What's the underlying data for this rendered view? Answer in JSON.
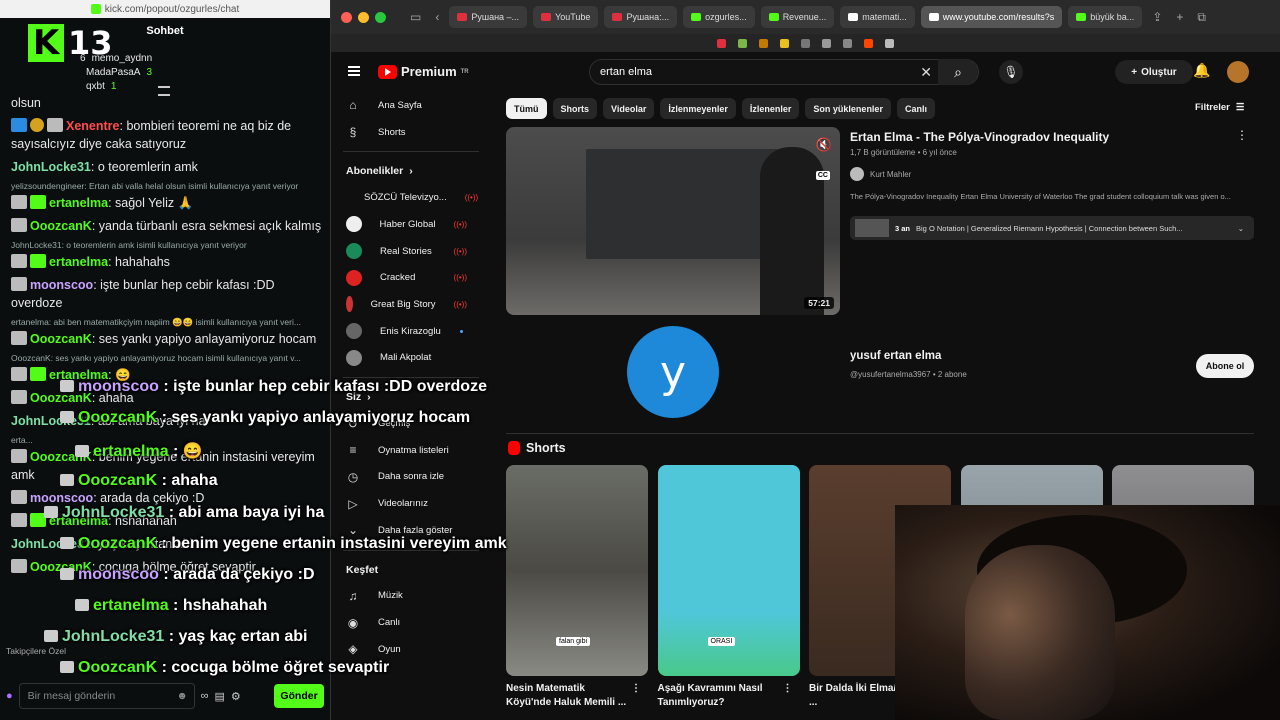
{
  "kick": {
    "url": "kick.com/popout/ozgurles/chat",
    "chat_title": "Sohbet",
    "viewer_k": "K",
    "viewer_count": "13",
    "leaders": [
      {
        "rank": "6",
        "name": "memo_aydnn",
        "val": ""
      },
      {
        "rank": "",
        "name": "MadaPasaA",
        "val": "3"
      },
      {
        "rank": "",
        "name": "qxbt",
        "val": "1"
      }
    ],
    "messages": [
      {
        "reply": "",
        "user": "",
        "color": "#e8e8e8",
        "badges": [],
        "text": "olsun"
      },
      {
        "reply": "",
        "user": "Xenentre",
        "color": "#ff4d4d",
        "badges": [
          "b-blue",
          "b-gold",
          "b-sub"
        ],
        "text": "bombieri teoremi ne aq biz de sayısalcıyız diye caka satıyoruz"
      },
      {
        "reply": "",
        "user": "JohnLocke31",
        "color": "#7ee0a6",
        "badges": [],
        "text": "o teoremlerin amk"
      },
      {
        "reply": "yelizsoundengineer: Ertan abi valla helal olsun isimli kullanıcıya yanıt veriyor",
        "user": "ertanelma",
        "color": "#53fc18",
        "badges": [
          "b-sub",
          "b-gift"
        ],
        "text": "sağol Yeliz 🙏"
      },
      {
        "reply": "",
        "user": "OoozcanK",
        "color": "#53fc18",
        "badges": [
          "b-sub"
        ],
        "text": "yanda türbanlı esra sekmesi açık kalmış"
      },
      {
        "reply": "JohnLocke31: o teoremlerin amk isimli kullanıcıya yanıt veriyor",
        "user": "ertanelma",
        "color": "#53fc18",
        "badges": [
          "b-sub",
          "b-gift"
        ],
        "text": "hahahahs"
      },
      {
        "reply": "",
        "user": "moonscoo",
        "color": "#c8a2ff",
        "badges": [
          "b-sub"
        ],
        "text": "işte bunlar hep cebir kafası :DD overdoze"
      },
      {
        "reply": "ertanelma: abi ben matematikçiyim napiim 😄😄 isimli kullanıcıya yanıt veri...",
        "user": "OoozcanK",
        "color": "#53fc18",
        "badges": [
          "b-sub"
        ],
        "text": "ses yankı yapiyo anlayamiyoruz hocam"
      },
      {
        "reply": "OoozcanK: ses yankı yapiyo anlayamiyoruz hocam isimli kullanıcıya yanıt v...",
        "user": "ertanelma",
        "color": "#53fc18",
        "badges": [
          "b-sub",
          "b-gift"
        ],
        "text": "😄"
      },
      {
        "reply": "",
        "user": "OoozcanK",
        "color": "#53fc18",
        "badges": [
          "b-sub"
        ],
        "text": "ahaha"
      },
      {
        "reply": "",
        "user": "JohnLocke31",
        "color": "#7ee0a6",
        "badges": [],
        "text": "abi ama baya iyi ha"
      },
      {
        "reply": "erta...",
        "user": "OoozcanK",
        "color": "#53fc18",
        "badges": [
          "b-sub"
        ],
        "text": "benim yegene ertanin instasini vereyim amk"
      },
      {
        "reply": "",
        "user": "moonscoo",
        "color": "#c8a2ff",
        "badges": [
          "b-sub"
        ],
        "text": "arada da çekiyo :D"
      },
      {
        "reply": "",
        "user": "ertanelma",
        "color": "#53fc18",
        "badges": [
          "b-sub",
          "b-gift"
        ],
        "text": "hshahahah"
      },
      {
        "reply": "",
        "user": "JohnLocke31",
        "color": "#7ee0a6",
        "badges": [],
        "text": "yaş kaç ertan abi"
      },
      {
        "reply": "",
        "user": "OoozcanK",
        "color": "#53fc18",
        "badges": [
          "b-sub"
        ],
        "text": "cocuga bölme öğret sevaptir"
      }
    ],
    "follow_note": "Takipçilere Özel",
    "input_placeholder": "Bir mesaj gönderin",
    "send_label": "Gönder"
  },
  "overlay": [
    {
      "user": "moonscoo",
      "color": "#c8a2ff",
      "text": " : işte bunlar hep cebir kafası :DD overdoze"
    },
    {
      "user": "OoozcanK",
      "color": "#53fc18",
      "text": " : ses yankı yapiyo anlayamiyoruz hocam"
    },
    {
      "user": "ertanelma",
      "color": "#53fc18",
      "text": " : 😄"
    },
    {
      "user": "OoozcanK",
      "color": "#53fc18",
      "text": " : ahaha"
    },
    {
      "user": "JohnLocke31",
      "color": "#7ee0a6",
      "text": " : abi ama baya iyi ha"
    },
    {
      "user": "OoozcanK",
      "color": "#53fc18",
      "text": " : benim yegene ertanin instasini vereyim amk"
    },
    {
      "user": "moonscoo",
      "color": "#c8a2ff",
      "text": " : arada da çekiyo :D"
    },
    {
      "user": "ertanelma",
      "color": "#53fc18",
      "text": " : hshahahah"
    },
    {
      "user": "JohnLocke31",
      "color": "#7ee0a6",
      "text": " : yaş kaç ertan abi"
    },
    {
      "user": "OoozcanK",
      "color": "#53fc18",
      "text": " : cocuga bölme öğret sevaptir"
    }
  ],
  "tabs": [
    {
      "label": "Рушана –...",
      "color": "#e03040"
    },
    {
      "label": "YouTube",
      "color": "#e03040"
    },
    {
      "label": "Рушана:...",
      "color": "#e03040"
    },
    {
      "label": "ozgurles...",
      "color": "#53fc18"
    },
    {
      "label": "Revenue...",
      "color": "#53fc18"
    },
    {
      "label": "matemati...",
      "color": "#ffffff"
    },
    {
      "label": "www.youtube.com/results?s",
      "color": "#ffffff",
      "active": true
    },
    {
      "label": "büyük ba...",
      "color": "#53fc18"
    }
  ],
  "youtube": {
    "brand": "Premium",
    "brand_sup": "TR",
    "search_value": "ertan elma",
    "create_label": "Oluştur",
    "sidebar": {
      "top": [
        {
          "label": "Ana Sayfa",
          "icon": "⌂"
        },
        {
          "label": "Shorts",
          "icon": "§"
        }
      ],
      "subs_heading": "Abonelikler",
      "subs": [
        {
          "label": "SÖZCÜ Televizyo...",
          "color": "#9ab",
          "live": "((•))"
        },
        {
          "label": "Haber Global",
          "color": "#eee",
          "live": "((•))"
        },
        {
          "label": "Real Stories",
          "color": "#1a8a5a",
          "live": "((•))"
        },
        {
          "label": "Cracked",
          "color": "#d22",
          "live": "((•))"
        },
        {
          "label": "Great Big Story",
          "color": "#c33",
          "live": "((•))"
        },
        {
          "label": "Enis Kirazoglu",
          "color": "#666",
          "live": ""
        },
        {
          "label": "Mali Akpolat",
          "color": "#888",
          "live": ""
        }
      ],
      "you_heading": "Siz",
      "you": [
        {
          "label": "Geçmiş",
          "icon": "↺"
        },
        {
          "label": "Oynatma listeleri",
          "icon": "≡"
        },
        {
          "label": "Daha sonra izle",
          "icon": "◷"
        },
        {
          "label": "Videolarınız",
          "icon": "▷"
        },
        {
          "label": "Daha fazla göster",
          "icon": "⌄"
        }
      ],
      "explore_heading": "Keşfet",
      "explore": [
        {
          "label": "Müzik",
          "icon": "♫"
        },
        {
          "label": "Canlı",
          "icon": "◉"
        },
        {
          "label": "Oyun",
          "icon": "◈"
        }
      ]
    },
    "chips": [
      "Tümü",
      "Shorts",
      "Videolar",
      "İzlenmeyenler",
      "İzlenenler",
      "Son yüklenenler",
      "Canlı"
    ],
    "filters_label": "Filtreler",
    "video": {
      "title": "Ertan Elma - The Pólya-Vinogradov Inequality",
      "meta": "1,7 B görüntüleme • 6 yıl önce",
      "channel": "Kurt Mahler",
      "desc": "The Pólya-Vinogradov Inequality Ertan Elma University of Waterloo The grad student colloquium talk was given o...",
      "chapters_count": "3 an",
      "chapters": "Big O Notation | Generalized Riemann Hypothesis | Connection between Such...",
      "duration": "57:21",
      "cc": "CC"
    },
    "channel": {
      "initial": "y",
      "name": "yusuf ertan elma",
      "handle": "@yusufertanelma3967 • 2 abone",
      "subscribe_label": "Abone ol"
    },
    "shorts_heading": "Shorts",
    "shorts": [
      {
        "title": "Nesin Matematik Köyü'nde Haluk Memili ...",
        "caption": "falan gibi",
        "bg": "linear-gradient(180deg,#6a6d66 0%,#4b4a44 50%,#8a8a84 100%)"
      },
      {
        "title": "Aşağı Kavramını Nasıl Tanımlıyoruz?",
        "caption": "ORASI",
        "bg": "linear-gradient(180deg,#4fc7d9 0%,#4fc7d9 70%,#49c98a 100%)"
      },
      {
        "title": "Bir Dalda İki Elma/Gülşen ...",
        "caption": "",
        "bg": "linear-gradient(180deg,#5a3e2e 0%,#3a2a20 100%)"
      },
      {
        "title": "",
        "caption": "",
        "bg": "linear-gradient(180deg,#9aa4ab 0%,#5e6870 100%)"
      },
      {
        "title": "",
        "caption": "",
        "bg": "linear-gradient(180deg,#8f8f92 0%,#4e4e52 100%)"
      }
    ]
  }
}
